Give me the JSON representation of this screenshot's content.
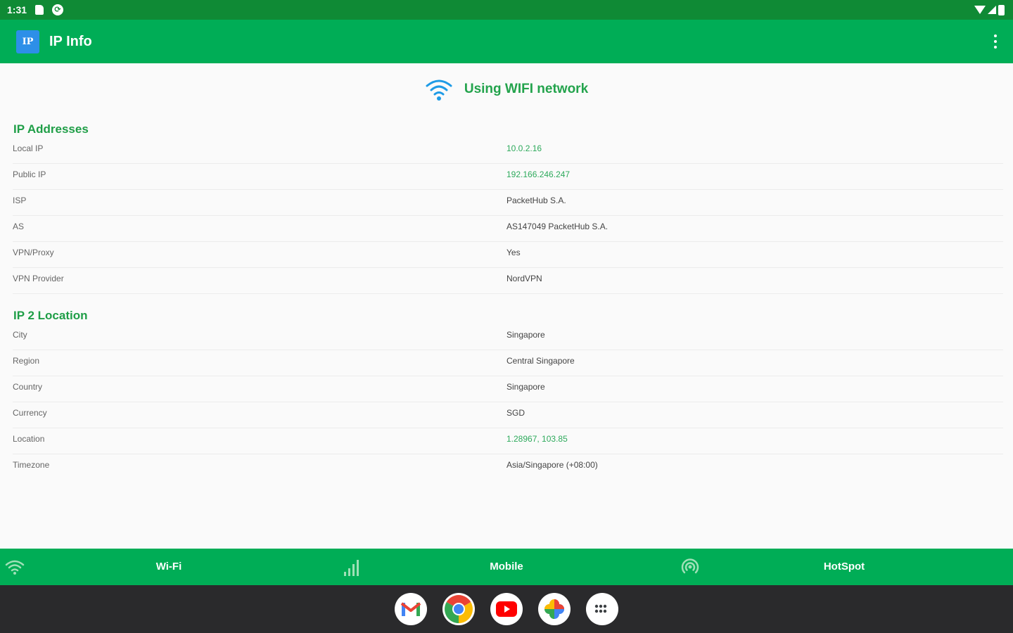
{
  "status_bar": {
    "time": "1:31"
  },
  "app_bar": {
    "logo_text": "IP",
    "title": "IP Info"
  },
  "network": {
    "text": "Using WIFI network"
  },
  "sections": [
    {
      "title": "IP Addresses",
      "rows": [
        {
          "label": "Local IP",
          "value": "10.0.2.16"
        },
        {
          "label": "Public IP",
          "value": "192.166.246.247"
        },
        {
          "label": "ISP",
          "value": "PacketHub S.A."
        },
        {
          "label": "AS",
          "value": "AS147049 PacketHub S.A."
        },
        {
          "label": "VPN/Proxy",
          "value": "Yes"
        },
        {
          "label": "VPN Provider",
          "value": "NordVPN"
        }
      ]
    },
    {
      "title": "IP 2 Location",
      "rows": [
        {
          "label": "City",
          "value": "Singapore"
        },
        {
          "label": "Region",
          "value": "Central Singapore"
        },
        {
          "label": "Country",
          "value": "Singapore"
        },
        {
          "label": "Currency",
          "value": "SGD"
        },
        {
          "label": "Location",
          "value": "1.28967, 103.85"
        },
        {
          "label": "Timezone",
          "value": "Asia/Singapore (+08:00)"
        }
      ]
    }
  ],
  "bottom_nav": [
    {
      "label": "Wi-Fi",
      "icon": "wifi-icon"
    },
    {
      "label": "Mobile",
      "icon": "signal-bars-icon"
    },
    {
      "label": "HotSpot",
      "icon": "hotspot-icon"
    }
  ],
  "taskbar": {
    "apps": [
      "gmail-icon",
      "chrome-icon",
      "youtube-icon",
      "photos-icon",
      "app-drawer-icon"
    ]
  },
  "colors": {
    "primary": "#00ad56",
    "status_bar": "#0f8a35",
    "accent_text": "#1f9e47",
    "wifi_blue": "#1e9be6",
    "taskbar": "#2a2a2c"
  }
}
